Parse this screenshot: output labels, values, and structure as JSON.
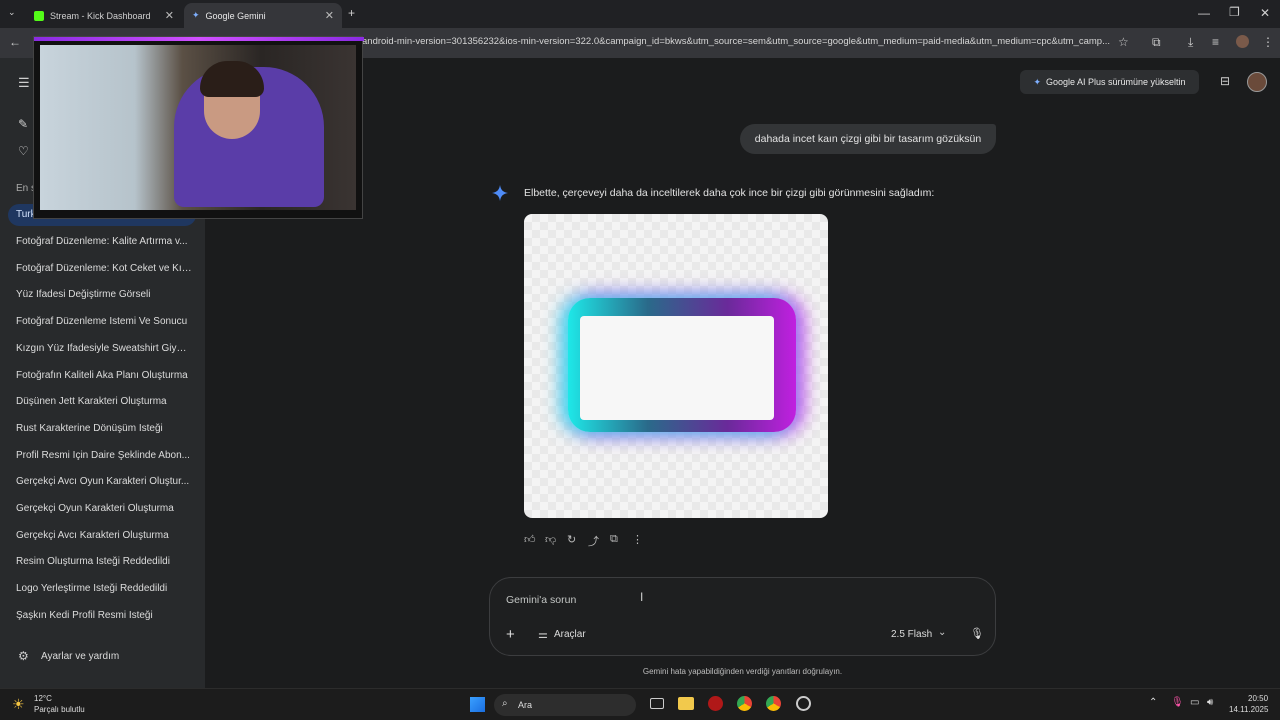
{
  "browser": {
    "tabs": [
      {
        "label": "Stream - Kick Dashboard",
        "active": false
      },
      {
        "label": "Google Gemini",
        "active": true
      }
    ],
    "url": "android-min-version=301356232&ios-min-version=322.0&campaign_id=bkws&utm_source=sem&utm_source=google&utm_medium=paid-media&utm_medium=cpc&utm_camp..."
  },
  "sidebar": {
    "section_label": "En s",
    "active_item": "Turk",
    "items": [
      "Fotoğraf Düzenleme: Kalite Artırma v...",
      "Fotoğraf Düzenleme: Kot Ceket ve Kız...",
      "Yüz İfadesi Değiştirme Görseli",
      "Fotoğraf Düzenleme İstemi Ve Sonucu",
      "Kızgın Yüz İfadesiyle Sweatshirt Giydi...",
      "Fotoğrafın Kaliteli Aka Planı Oluşturma",
      "Düşünen Jett Karakteri Oluşturma",
      "Rust Karakterine Dönüşüm İsteği",
      "Profil Resmi İçin Daire Şeklinde Abon...",
      "Gerçekçi Avcı Oyun Karakteri Oluştur...",
      "Gerçekçi Oyun Karakteri Oluşturma",
      "Gerçekçi Avcı Karakteri Oluşturma",
      "Resim Oluşturma İsteği Reddedildi",
      "Logo Yerleştirme İsteği Reddedildi",
      "Şaşkın Kedi Profil Resmi İsteği"
    ],
    "settings_label": "Ayarlar ve yardım"
  },
  "header": {
    "upgrade_label": "Google AI Plus sürümüne yükseltin"
  },
  "chat": {
    "user_message": "dahada incet kaın çizgi gibi bir tasarım gözüksün",
    "model_response": "Elbette, çerçeveyi daha da inceltilerek daha çok ince bir çizgi gibi görünmesini sağladım:"
  },
  "input": {
    "placeholder": "Gemini'a sorun",
    "tools_label": "Araçlar",
    "model_label": "2.5 Flash"
  },
  "disclaimer": "Gemini hata yapabildiğinden verdiği yanıtları doğrulayın.",
  "taskbar": {
    "weather_temp": "12°C",
    "weather_desc": "Parçalı bulutlu",
    "search_label": "Ara",
    "time": "20:50",
    "date": "14.11.2025"
  }
}
